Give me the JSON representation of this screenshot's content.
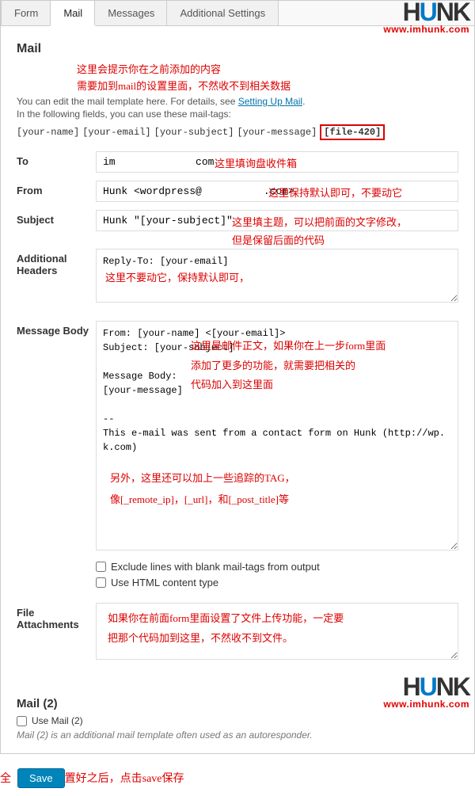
{
  "tabs": {
    "form": "Form",
    "mail": "Mail",
    "messages": "Messages",
    "additional": "Additional Settings"
  },
  "logo": {
    "text_pre": "H",
    "text_u": "U",
    "text_post": "NK",
    "url": "www.imhunk.com"
  },
  "section_title": "Mail",
  "note_top1": "这里会提示你在之前添加的内容",
  "note_top2": "需要加到mail的设置里面，不然收不到相关数据",
  "desc1_pre": "You can edit the mail template here. For details, see ",
  "desc1_link": "Setting Up Mail",
  "desc1_post": ".",
  "desc2": "In the following fields, you can use these mail-tags:",
  "tags": {
    "t1": "[your-name]",
    "t2": "[your-email]",
    "t3": "[your-subject]",
    "t4": "[your-message]",
    "t5": "[file-420]"
  },
  "labels": {
    "to": "To",
    "from": "From",
    "subject": "Subject",
    "headers": "Additional Headers",
    "body": "Message Body",
    "attach": "File Attachments"
  },
  "values": {
    "to": "im             com",
    "from": "Hunk <wordpress@          .com>",
    "subject": "Hunk \"[your-subject]\"",
    "headers": "Reply-To: [your-email]",
    "body": "From: [your-name] <[your-email]>\nSubject: [your-subject]\n\nMessage Body:\n[your-message]\n\n--\nThis e-mail was sent from a contact form on Hunk (http://wp.     k.com)",
    "attach": ""
  },
  "inline_notes": {
    "to": "这里填询盘收件箱",
    "from": "这里保持默认即可，不要动它",
    "subject1": "这里填主题，可以把前面的文字修改，",
    "subject2": "但是保留后面的代码",
    "headers": "这里不要动它，保持默认即可，",
    "body1": "这里是邮件正文，如果你在上一步form里面",
    "body2": "添加了更多的功能，就需要把相关的",
    "body3": "代码加入到这里面",
    "track1": "另外，这里还可以加上一些追踪的TAG，",
    "track2": "像[_remote_ip]，[_url]，和[_post_title]等",
    "attach1": "如果你在前面form里面设置了文件上传功能，一定要",
    "attach2": "把那个代码加到这里，不然收不到文件。"
  },
  "checkboxes": {
    "exclude": "Exclude lines with blank mail-tags from output",
    "html": "Use HTML content type",
    "mail2": "Use Mail (2)"
  },
  "mail2_title": "Mail (2)",
  "mail2_hint": "Mail (2) is an additional mail template often used as an autoresponder.",
  "save_label": "Save",
  "save_note_pre": "全",
  "save_note_post": "置好之后，点击save保存"
}
